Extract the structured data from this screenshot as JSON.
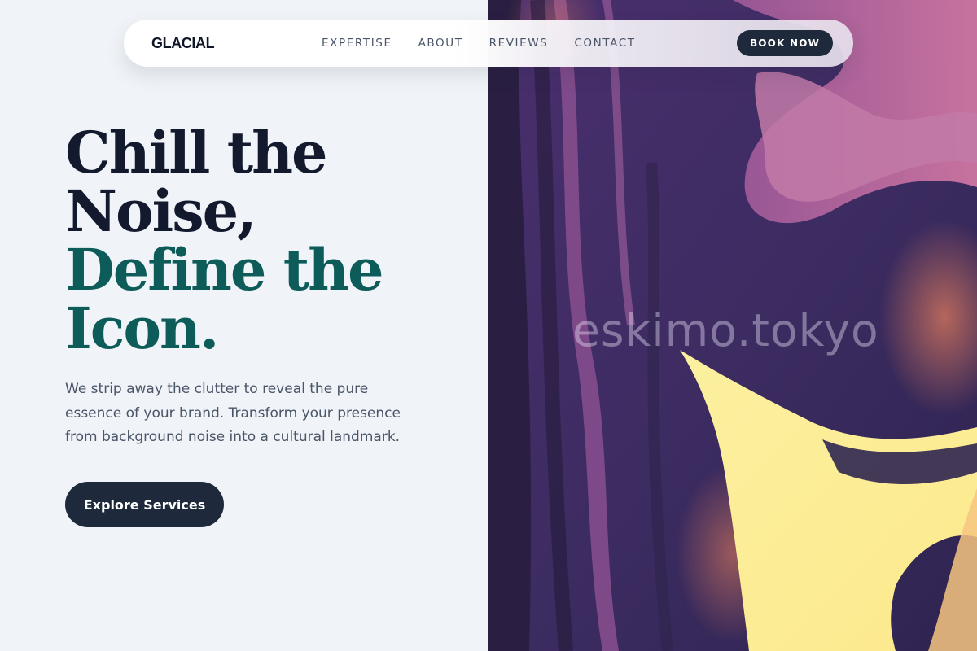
{
  "brand": {
    "name": "GLACIAL"
  },
  "nav": {
    "links": [
      "EXPERTISE",
      "ABOUT",
      "REVIEWS",
      "CONTACT"
    ],
    "cta_label": "BOOK NOW"
  },
  "hero": {
    "headline_line1": "Chill the",
    "headline_line2": "Noise,",
    "headline_line3": "Define the",
    "headline_line4": "Icon.",
    "description": "We strip away the clutter to reveal the pure essence of your brand. Transform your presence from background noise into a cultural landmark.",
    "cta_label": "Explore Services"
  },
  "image": {
    "watermark": "eskimo.tokyo"
  },
  "colors": {
    "background": "#f0f4f8",
    "headline_dark": "#131a2e",
    "headline_accent": "#0d5c5a",
    "button": "#1e293b",
    "text_muted": "#4a5568"
  }
}
